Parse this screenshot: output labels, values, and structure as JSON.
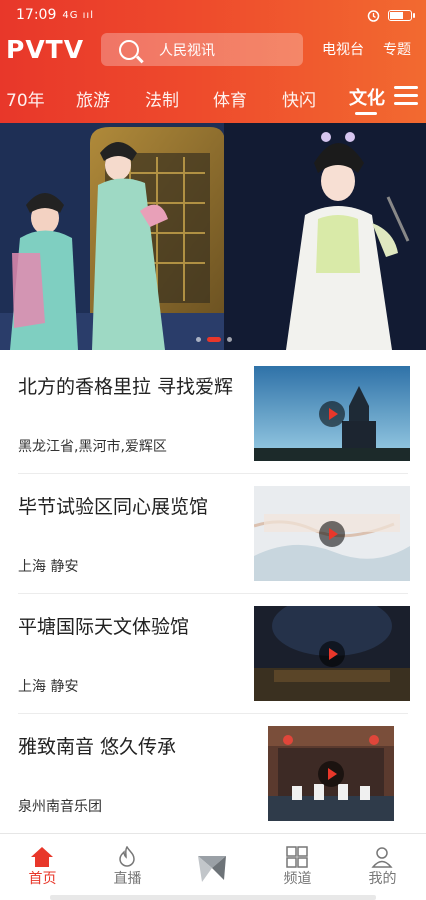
{
  "status_bar": {
    "time": "17:09",
    "signal": "4G ııl",
    "icons": [
      "alarm-icon",
      "battery-icon"
    ]
  },
  "header": {
    "logo": "PVTV",
    "search_placeholder": "人民视讯",
    "tv_link": "电视台",
    "topic_link": "专题"
  },
  "tabs": [
    "70年",
    "旅游",
    "法制",
    "体育",
    "快闪",
    "文化"
  ],
  "active_tab": "文化",
  "banner": {
    "slide_count": 3,
    "active_slide": 2
  },
  "articles": [
    {
      "title": "北方的香格里拉 寻找爱辉",
      "location": "黑龙江省,黑河市,爱辉区"
    },
    {
      "title": "毕节试验区同心展览馆",
      "location": "上海 静安"
    },
    {
      "title": "平塘国际天文体验馆",
      "location": "上海 静安"
    },
    {
      "title": "雅致南音 悠久传承",
      "location": "泉州南音乐团"
    }
  ],
  "bottom_nav": [
    "首页",
    "直播",
    "",
    "频道",
    "我的"
  ],
  "colors": {
    "brand_red": "#e8372a",
    "brand_orange": "#f26a30"
  }
}
